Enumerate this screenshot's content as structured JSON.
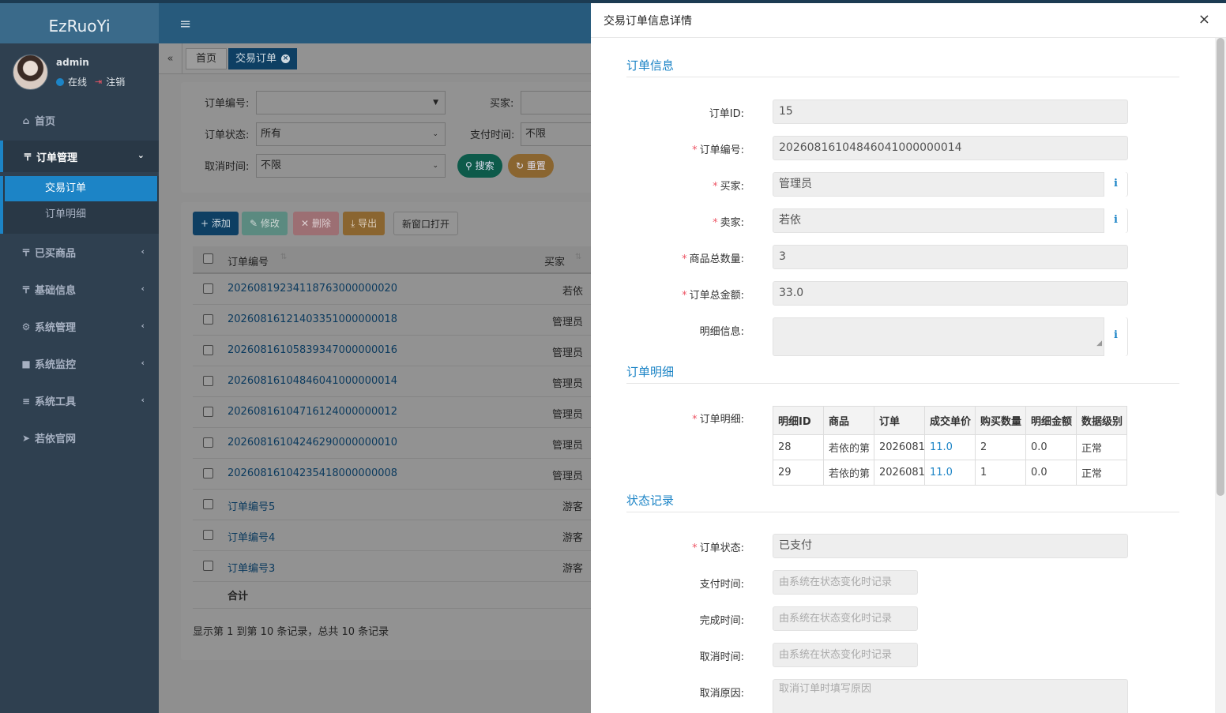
{
  "sidebar": {
    "brand": "EzRuoYi",
    "user": {
      "name": "admin",
      "status": "在线",
      "logout": "注销"
    },
    "nav": [
      {
        "label": "首页",
        "icon": "home-icon"
      },
      {
        "label": "订单管理",
        "icon": "grid-icon"
      },
      {
        "label": "已买商品",
        "icon": "grid-icon"
      },
      {
        "label": "基础信息",
        "icon": "grid-icon"
      },
      {
        "label": "系统管理",
        "icon": "gear-icon"
      },
      {
        "label": "系统监控",
        "icon": "video-icon"
      },
      {
        "label": "系统工具",
        "icon": "bars-icon"
      },
      {
        "label": "若依官网",
        "icon": "send-icon"
      }
    ],
    "sub": [
      "交易订单",
      "订单明细"
    ]
  },
  "tabs": {
    "home": "首页",
    "active": "交易订单"
  },
  "search": {
    "order_no_label": "订单编号:",
    "buyer_label": "买家:",
    "status_label": "订单状态:",
    "status_value": "所有",
    "pay_time_label": "支付时间:",
    "pay_time_value": "不限",
    "cancel_time_label": "取消时间:",
    "cancel_time_value": "不限",
    "search_btn": "搜索",
    "reset_btn": "重置"
  },
  "toolbar": {
    "add": "添加",
    "edit": "修改",
    "delete": "删除",
    "export": "导出",
    "new_window": "新窗口打开"
  },
  "table": {
    "headers": [
      "订单编号",
      "买家"
    ],
    "rows": [
      {
        "code": "20260819234118763000000020",
        "buyer": "若依"
      },
      {
        "code": "20260816121403351000000018",
        "buyer": "管理员"
      },
      {
        "code": "20260816105839347000000016",
        "buyer": "管理员"
      },
      {
        "code": "20260816104846041000000014",
        "buyer": "管理员"
      },
      {
        "code": "20260816104716124000000012",
        "buyer": "管理员"
      },
      {
        "code": "20260816104246290000000010",
        "buyer": "管理员"
      },
      {
        "code": "20260816104235418000000008",
        "buyer": "管理员"
      },
      {
        "code": "订单编号5",
        "buyer": "游客"
      },
      {
        "code": "订单编号4",
        "buyer": "游客"
      },
      {
        "code": "订单编号3",
        "buyer": "游客"
      }
    ],
    "total_label": "合计",
    "pagination": "显示第 1 到第 10 条记录，总共 10 条记录"
  },
  "drawer": {
    "title": "交易订单信息详情",
    "sections": {
      "info": "订单信息",
      "detail": "订单明细",
      "status": "状态记录"
    },
    "fields": {
      "id_label": "订单ID:",
      "id": "15",
      "no_label": "订单编号:",
      "no": "20260816104846041000000014",
      "buyer_label": "买家:",
      "buyer": "管理员",
      "seller_label": "卖家:",
      "seller": "若依",
      "qty_label": "商品总数量:",
      "qty": "3",
      "amount_label": "订单总金额:",
      "amount": "33.0",
      "detail_info_label": "明细信息:",
      "detail_label": "订单明细:",
      "status_label": "订单状态:",
      "status": "已支付",
      "pay_time_label": "支付时间:",
      "pay_time_ph": "由系统在状态变化时记录",
      "done_time_label": "完成时间:",
      "done_time_ph": "由系统在状态变化时记录",
      "cancel_time_label": "取消时间:",
      "cancel_time_ph": "由系统在状态变化时记录",
      "cancel_reason_label": "取消原因:",
      "cancel_reason_ph": "取消订单时填写原因"
    },
    "detail_table": {
      "headers": [
        "明细ID",
        "商品",
        "订单",
        "成交单价",
        "购买数量",
        "明细金额",
        "数据级别"
      ],
      "rows": [
        [
          "28",
          "若依的第",
          "2026081",
          "11.0",
          "2",
          "0.0",
          "正常"
        ],
        [
          "29",
          "若依的第",
          "2026081",
          "11.0",
          "1",
          "0.0",
          "正常"
        ]
      ]
    }
  }
}
